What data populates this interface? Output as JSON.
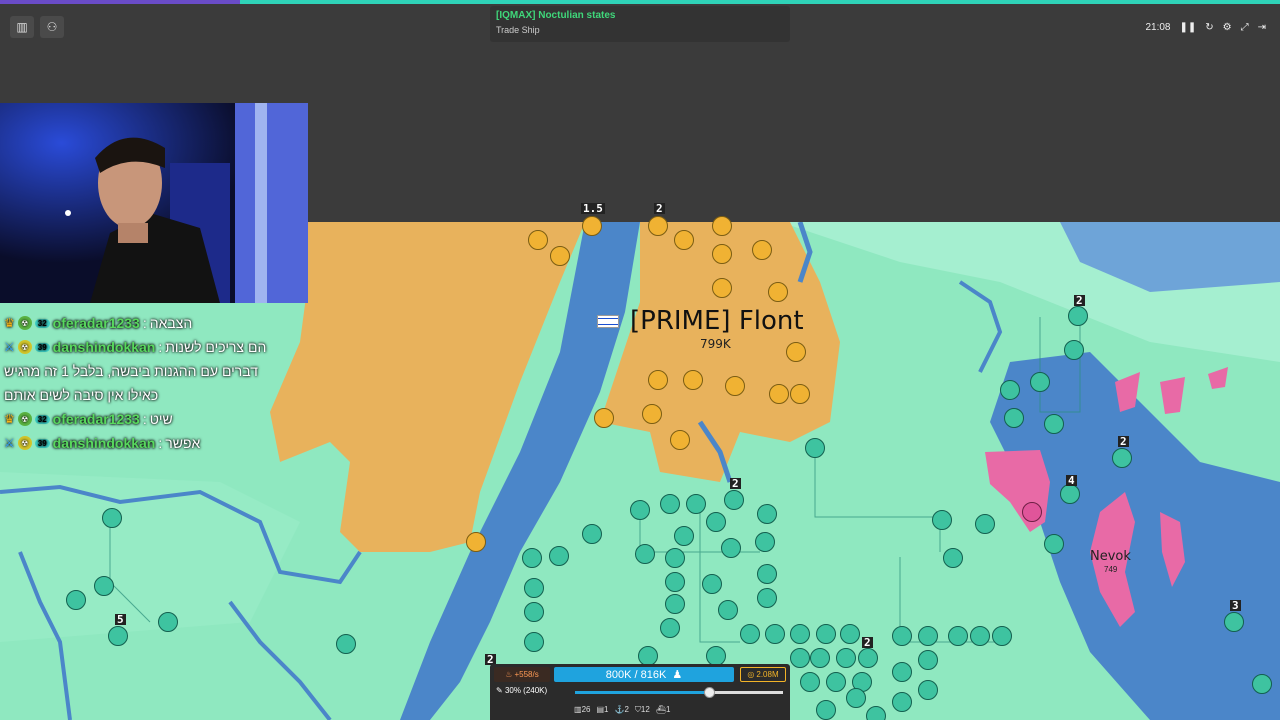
{
  "notification": {
    "title": "[IQMAX] Noctulian states",
    "subtitle": "Trade Ship"
  },
  "top_controls": {
    "time": "21:08"
  },
  "map_labels": {
    "prime_name": "[PRIME] Flont",
    "prime_pop": "799K",
    "nevok_name": "Nevok",
    "nevok_pop": "749",
    "numbers": [
      "1.5",
      "2",
      "2",
      "2",
      "2",
      "4",
      "5",
      "2",
      "2",
      "3",
      "2"
    ]
  },
  "chat": [
    {
      "user": "oferadar1233",
      "level": "32",
      "role": "crown",
      "message": "הצבאה"
    },
    {
      "user": "danshindokkan",
      "level": "39",
      "role": "sword",
      "message": "הם צריכים לשנות"
    },
    {
      "wrap": "דברים עם ההגנות ביבשה, בלבל 1 זה מרגיש"
    },
    {
      "wrap": "כאילו אין סיבה לשים אותם"
    },
    {
      "user": "oferadar1233",
      "level": "32",
      "role": "crown",
      "message": "שיט"
    },
    {
      "user": "danshindokkan",
      "level": "39",
      "role": "sword",
      "message": "אפשר"
    }
  ],
  "panel": {
    "income": "+558/s",
    "troops": "800K / 816K",
    "gold": "2.08M",
    "attack_ratio": "30% (240K)",
    "attack_ratio_value": 0.3,
    "counts": {
      "cities": "26",
      "factories": "1",
      "ports": "2",
      "defenses": "12",
      "warships": "1"
    }
  },
  "colors": {
    "land": "#8fe8c0",
    "prime_territory": "#e8b25c",
    "pink_territory": "#e86aa6",
    "water": "#4b86c9",
    "bar": "#1fa3de"
  }
}
